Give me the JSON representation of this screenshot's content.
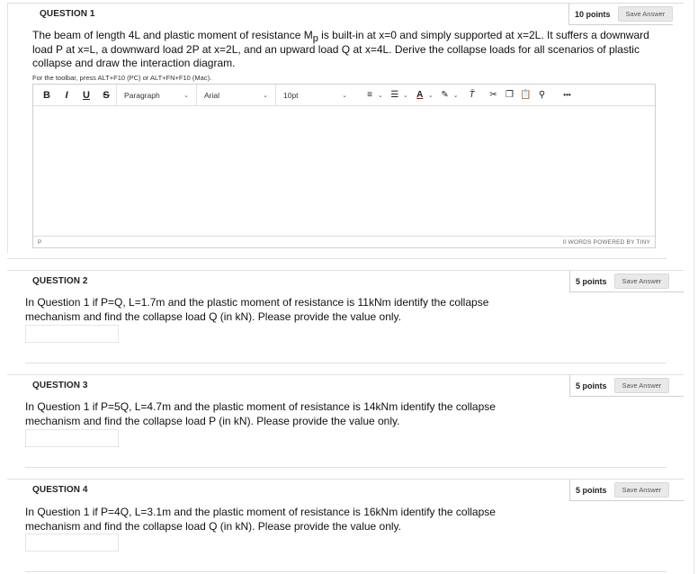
{
  "q1": {
    "header": "QUESTION 1",
    "points": "10 points",
    "save_label": "Save Answer",
    "text_a": "The beam of length 4L and plastic moment of resistance M",
    "text_sub": "p",
    "text_b": " is built-in at x=0 and simply supported at x=2L. It suffers a downward load P at x=L, a downward load 2P at x=2L, and an upward load Q at x=4L. Derive the collapse loads for all scenarios of plastic collapse and draw the interaction diagram.",
    "hint": "For the toolbar, press ALT+F10 (PC) or ALT+FN+F10 (Mac).",
    "toolbar": {
      "bold": "B",
      "italic": "I",
      "underline": "U",
      "strike": "S",
      "paragraph": "Paragraph",
      "font": "Arial",
      "size": "10pt",
      "more": "•••"
    },
    "status_path": "P",
    "status_words": "0 WORDS  POWERED BY TINY"
  },
  "q2": {
    "header": "QUESTION 2",
    "points": "5 points",
    "save_label": "Save Answer",
    "text": "In Question 1 if P=Q, L=1.7m and the plastic moment of resistance is 11kNm identify the collapse mechanism and find the collapse load Q (in kN). Please provide the value only.",
    "answer": ""
  },
  "q3": {
    "header": "QUESTION 3",
    "points": "5 points",
    "save_label": "Save Answer",
    "text": "In Question 1 if P=5Q, L=4.7m and the plastic moment of resistance is 14kNm identify the collapse mechanism and find the collapse load P (in kN). Please provide the value only.",
    "answer": ""
  },
  "q4": {
    "header": "QUESTION 4",
    "points": "5 points",
    "save_label": "Save Answer",
    "text": "In Question 1 if P=4Q, L=3.1m and the plastic moment of resistance is 16kNm identify the collapse mechanism and find the collapse load Q (in kN). Please provide the value only.",
    "answer": ""
  }
}
